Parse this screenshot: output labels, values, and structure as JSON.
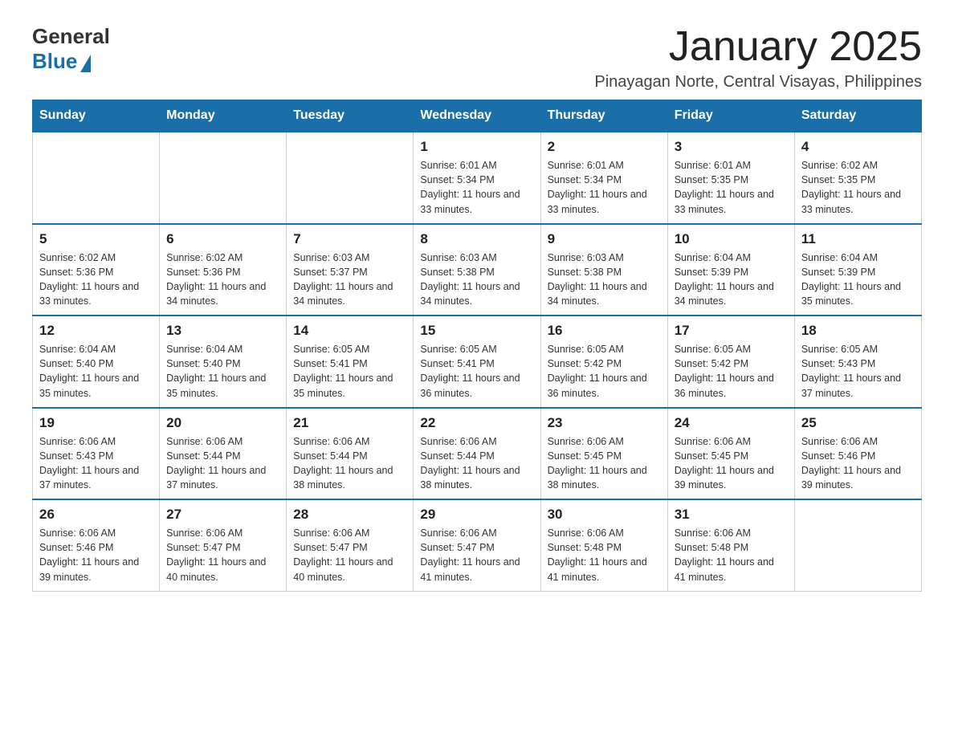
{
  "header": {
    "logo_general": "General",
    "logo_blue": "Blue",
    "month_title": "January 2025",
    "location": "Pinayagan Norte, Central Visayas, Philippines"
  },
  "days_of_week": [
    "Sunday",
    "Monday",
    "Tuesday",
    "Wednesday",
    "Thursday",
    "Friday",
    "Saturday"
  ],
  "weeks": [
    [
      {
        "day": "",
        "info": ""
      },
      {
        "day": "",
        "info": ""
      },
      {
        "day": "",
        "info": ""
      },
      {
        "day": "1",
        "info": "Sunrise: 6:01 AM\nSunset: 5:34 PM\nDaylight: 11 hours and 33 minutes."
      },
      {
        "day": "2",
        "info": "Sunrise: 6:01 AM\nSunset: 5:34 PM\nDaylight: 11 hours and 33 minutes."
      },
      {
        "day": "3",
        "info": "Sunrise: 6:01 AM\nSunset: 5:35 PM\nDaylight: 11 hours and 33 minutes."
      },
      {
        "day": "4",
        "info": "Sunrise: 6:02 AM\nSunset: 5:35 PM\nDaylight: 11 hours and 33 minutes."
      }
    ],
    [
      {
        "day": "5",
        "info": "Sunrise: 6:02 AM\nSunset: 5:36 PM\nDaylight: 11 hours and 33 minutes."
      },
      {
        "day": "6",
        "info": "Sunrise: 6:02 AM\nSunset: 5:36 PM\nDaylight: 11 hours and 34 minutes."
      },
      {
        "day": "7",
        "info": "Sunrise: 6:03 AM\nSunset: 5:37 PM\nDaylight: 11 hours and 34 minutes."
      },
      {
        "day": "8",
        "info": "Sunrise: 6:03 AM\nSunset: 5:38 PM\nDaylight: 11 hours and 34 minutes."
      },
      {
        "day": "9",
        "info": "Sunrise: 6:03 AM\nSunset: 5:38 PM\nDaylight: 11 hours and 34 minutes."
      },
      {
        "day": "10",
        "info": "Sunrise: 6:04 AM\nSunset: 5:39 PM\nDaylight: 11 hours and 34 minutes."
      },
      {
        "day": "11",
        "info": "Sunrise: 6:04 AM\nSunset: 5:39 PM\nDaylight: 11 hours and 35 minutes."
      }
    ],
    [
      {
        "day": "12",
        "info": "Sunrise: 6:04 AM\nSunset: 5:40 PM\nDaylight: 11 hours and 35 minutes."
      },
      {
        "day": "13",
        "info": "Sunrise: 6:04 AM\nSunset: 5:40 PM\nDaylight: 11 hours and 35 minutes."
      },
      {
        "day": "14",
        "info": "Sunrise: 6:05 AM\nSunset: 5:41 PM\nDaylight: 11 hours and 35 minutes."
      },
      {
        "day": "15",
        "info": "Sunrise: 6:05 AM\nSunset: 5:41 PM\nDaylight: 11 hours and 36 minutes."
      },
      {
        "day": "16",
        "info": "Sunrise: 6:05 AM\nSunset: 5:42 PM\nDaylight: 11 hours and 36 minutes."
      },
      {
        "day": "17",
        "info": "Sunrise: 6:05 AM\nSunset: 5:42 PM\nDaylight: 11 hours and 36 minutes."
      },
      {
        "day": "18",
        "info": "Sunrise: 6:05 AM\nSunset: 5:43 PM\nDaylight: 11 hours and 37 minutes."
      }
    ],
    [
      {
        "day": "19",
        "info": "Sunrise: 6:06 AM\nSunset: 5:43 PM\nDaylight: 11 hours and 37 minutes."
      },
      {
        "day": "20",
        "info": "Sunrise: 6:06 AM\nSunset: 5:44 PM\nDaylight: 11 hours and 37 minutes."
      },
      {
        "day": "21",
        "info": "Sunrise: 6:06 AM\nSunset: 5:44 PM\nDaylight: 11 hours and 38 minutes."
      },
      {
        "day": "22",
        "info": "Sunrise: 6:06 AM\nSunset: 5:44 PM\nDaylight: 11 hours and 38 minutes."
      },
      {
        "day": "23",
        "info": "Sunrise: 6:06 AM\nSunset: 5:45 PM\nDaylight: 11 hours and 38 minutes."
      },
      {
        "day": "24",
        "info": "Sunrise: 6:06 AM\nSunset: 5:45 PM\nDaylight: 11 hours and 39 minutes."
      },
      {
        "day": "25",
        "info": "Sunrise: 6:06 AM\nSunset: 5:46 PM\nDaylight: 11 hours and 39 minutes."
      }
    ],
    [
      {
        "day": "26",
        "info": "Sunrise: 6:06 AM\nSunset: 5:46 PM\nDaylight: 11 hours and 39 minutes."
      },
      {
        "day": "27",
        "info": "Sunrise: 6:06 AM\nSunset: 5:47 PM\nDaylight: 11 hours and 40 minutes."
      },
      {
        "day": "28",
        "info": "Sunrise: 6:06 AM\nSunset: 5:47 PM\nDaylight: 11 hours and 40 minutes."
      },
      {
        "day": "29",
        "info": "Sunrise: 6:06 AM\nSunset: 5:47 PM\nDaylight: 11 hours and 41 minutes."
      },
      {
        "day": "30",
        "info": "Sunrise: 6:06 AM\nSunset: 5:48 PM\nDaylight: 11 hours and 41 minutes."
      },
      {
        "day": "31",
        "info": "Sunrise: 6:06 AM\nSunset: 5:48 PM\nDaylight: 11 hours and 41 minutes."
      },
      {
        "day": "",
        "info": ""
      }
    ]
  ]
}
